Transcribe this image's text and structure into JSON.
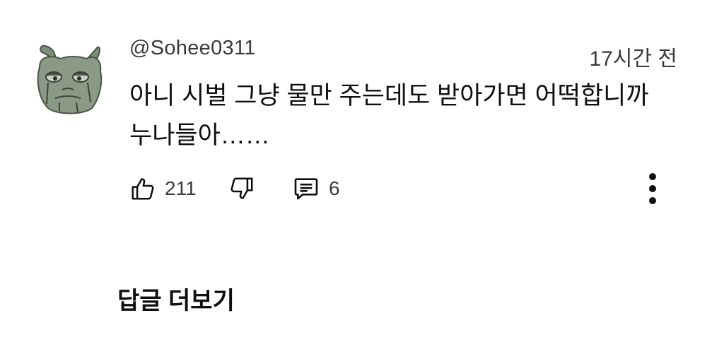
{
  "comment": {
    "username": "@Sohee0311",
    "timestamp": "17시간 전",
    "text": "아니 시벌 그냥 물만 주는데도 받아가면 어떡합니까\n누나들아……",
    "avatar_icon": "cartoon-frog-avatar",
    "likes": "211",
    "replies_count": "6"
  },
  "actions": {
    "like_icon": "thumbs-up-icon",
    "dislike_icon": "thumbs-down-icon",
    "reply_icon": "comment-icon",
    "more_icon": "more-vertical-icon"
  },
  "footer": {
    "view_replies_label": "답글 더보기"
  },
  "colors": {
    "text_primary": "#0f0f0f",
    "text_secondary": "#3a3a3a",
    "avatar_green": "#8a9a86",
    "background": "#ffffff"
  }
}
